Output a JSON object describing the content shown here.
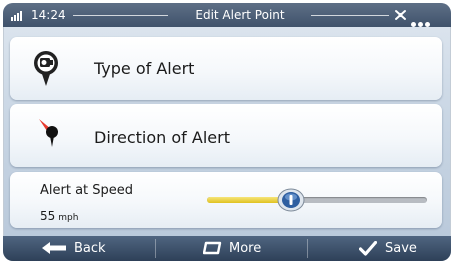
{
  "status": {
    "time": "14:24",
    "title": "Edit Alert Point"
  },
  "rows": [
    {
      "label": "Type of Alert",
      "icon": "speed-camera-alert-icon"
    },
    {
      "label": "Direction of Alert",
      "icon": "direction-pin-icon"
    }
  ],
  "speed": {
    "label": "Alert at Speed",
    "value": "55",
    "unit": "mph",
    "slider_fraction": 0.38
  },
  "toolbar": {
    "back_label": "Back",
    "more_label": "More",
    "save_label": "Save"
  },
  "colors": {
    "slider_fill": "#e0c21f",
    "slider_thumb": "#2f5fa0",
    "bar": "#3f526b"
  }
}
